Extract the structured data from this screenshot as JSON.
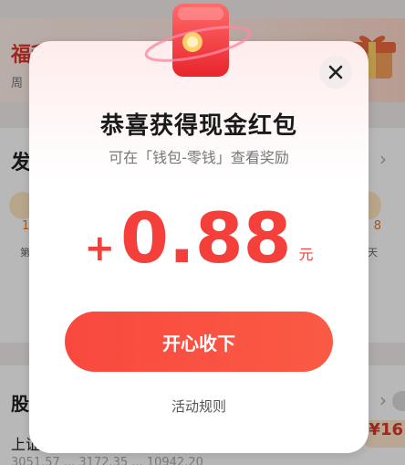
{
  "background": {
    "banner_title": "福利",
    "banner_sub": "周",
    "section1_title": "发",
    "coin_left_value": "1",
    "coin_right_value": "8",
    "tiny_left": "第",
    "tiny_right": "天",
    "section2_title": "股",
    "index_label": "上证",
    "index_values": "3051.57 ...   3172.35 ...   10942.20",
    "badge": "¥16"
  },
  "modal": {
    "title": "恭喜获得现金红包",
    "subtitle": "可在「钱包-零钱」查看奖励",
    "amount_sign": "+",
    "amount_value": "0.88",
    "amount_unit": "元",
    "accept_label": "开心收下",
    "rules_label": "活动规则"
  },
  "colors": {
    "accent_red": "#f43f3a",
    "button_red": "#f9493f"
  },
  "icons": {
    "close": "close-icon",
    "packet": "red-packet-icon",
    "gift": "gift-box-icon"
  }
}
